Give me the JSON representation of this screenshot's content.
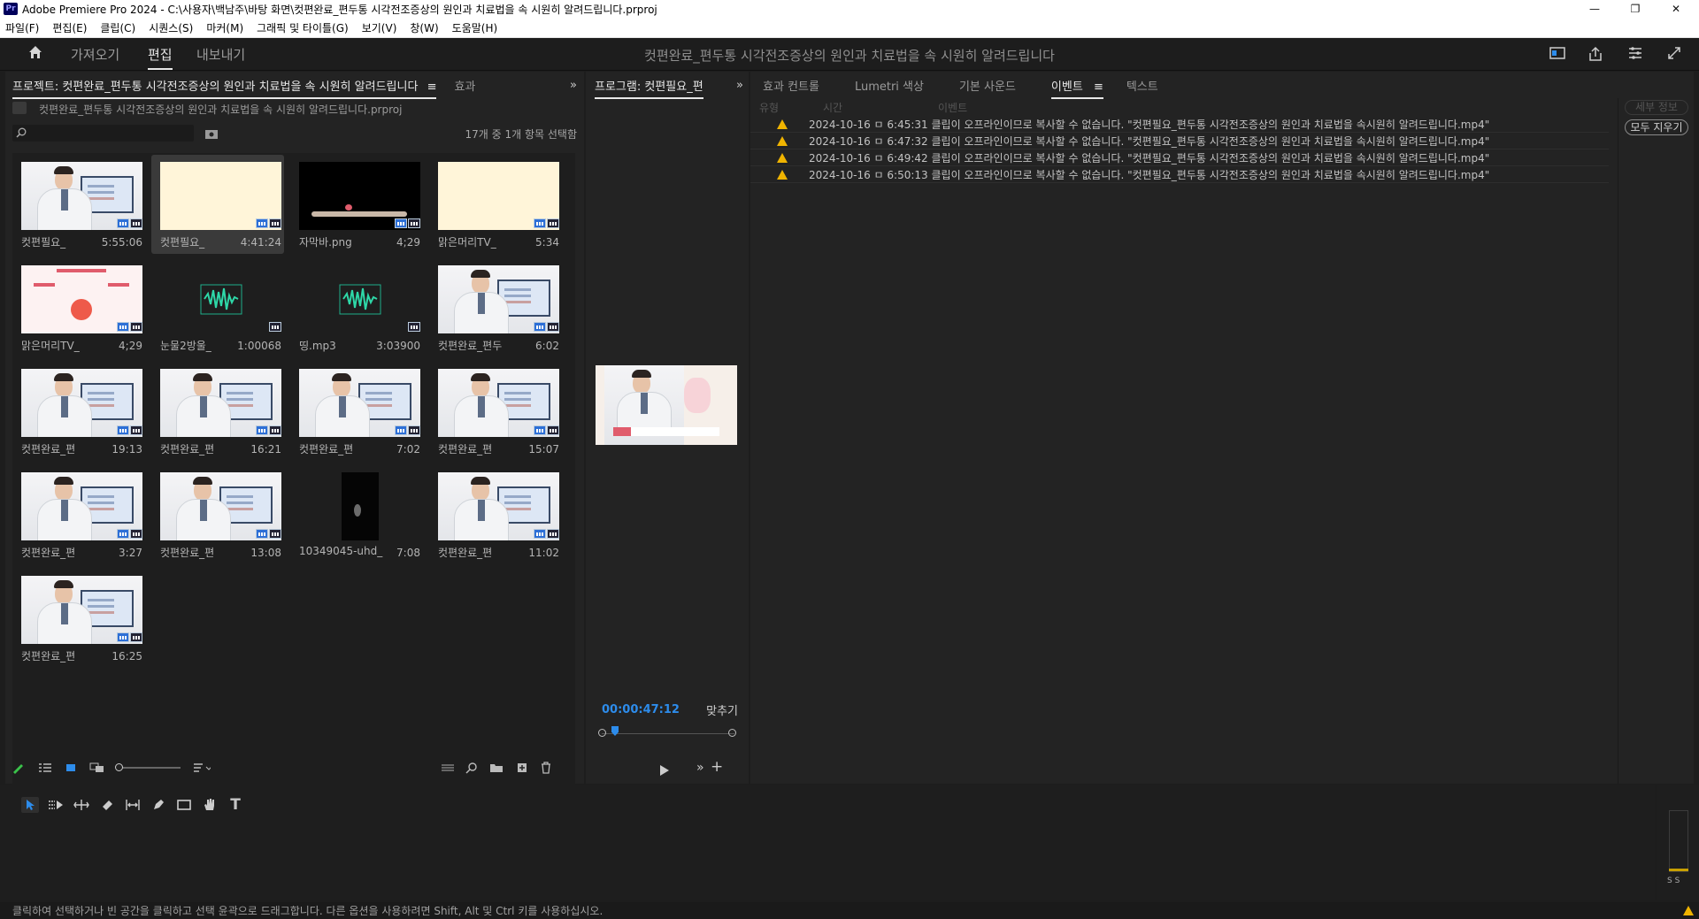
{
  "window": {
    "title": "Adobe Premiere Pro 2024 - C:\\사용자\\백남주\\바탕 화면\\컷편완료_편두통 시각전조증상의 원인과 치료법을 속 시원히 알려드립니다.prproj",
    "app_badge": "Pr",
    "controls": {
      "minimize": "—",
      "restore": "❐",
      "close": "✕"
    }
  },
  "menu": [
    "파일(F)",
    "편집(E)",
    "클립(C)",
    "시퀀스(S)",
    "마커(M)",
    "그래픽 및 타이틀(G)",
    "보기(V)",
    "창(W)",
    "도움말(H)"
  ],
  "header": {
    "tabs": {
      "import": "가져오기",
      "edit": "편집",
      "export": "내보내기"
    },
    "doc_title": "컷편완료_편두통 시각전조증상의 원인과 치료법을 속 시원히 알려드립니다"
  },
  "project_panel": {
    "tab_label": "프로젝트: 컷편완료_편두통 시각전조증상의 원인과 치료법을 속 시원히 알려드립니다",
    "menu_icon": "≡",
    "effects_tab": "효과",
    "overflow": "»",
    "file_name": "컷편완료_편두통 시각전조증상의 원인과 치료법을 속 시원히 알려드립니다.prproj",
    "search_placeholder": "",
    "selection_status": "17개 중 1개 항목 선택함",
    "clips": [
      {
        "name": "컷편필요_",
        "duration": "5:55:06",
        "type": "person"
      },
      {
        "name": "컷편필요_",
        "duration": "4:41:24",
        "type": "cream",
        "selected": true
      },
      {
        "name": "자막바.png",
        "duration": "4;29",
        "type": "black-bar"
      },
      {
        "name": "맑은머리TV_",
        "duration": "5:34",
        "type": "cream"
      },
      {
        "name": "맑은머리TV_",
        "duration": "4;29",
        "type": "slide"
      },
      {
        "name": "눈물2방울_",
        "duration": "1:00068",
        "type": "audio"
      },
      {
        "name": "띵.mp3",
        "duration": "3:03900",
        "type": "audio"
      },
      {
        "name": "컷편완료_편두",
        "duration": "6:02",
        "type": "person"
      },
      {
        "name": "컷편완료_편",
        "duration": "19:13",
        "type": "person"
      },
      {
        "name": "컷편완료_편",
        "duration": "16:21",
        "type": "person"
      },
      {
        "name": "컷편완료_편",
        "duration": "7:02",
        "type": "person"
      },
      {
        "name": "컷편완료_편",
        "duration": "15:07",
        "type": "person"
      },
      {
        "name": "컷편완료_편",
        "duration": "3:27",
        "type": "person"
      },
      {
        "name": "컷편완료_편",
        "duration": "13:08",
        "type": "person"
      },
      {
        "name": "10349045-uhd_",
        "duration": "7:08",
        "type": "dark-video"
      },
      {
        "name": "컷편완료_편",
        "duration": "11:02",
        "type": "person"
      },
      {
        "name": "컷편완료_편",
        "duration": "16:25",
        "type": "person"
      }
    ]
  },
  "program_panel": {
    "tab_label": "프로그램: 컷편필요_편",
    "overflow": "»",
    "timecode": "00:00:47:12",
    "fit_label": "맞추기"
  },
  "events_panel": {
    "tabs": {
      "effect_controls": "효과 컨트롤",
      "lumetri": "Lumetri 색상",
      "basic_sound": "기본 사운드",
      "events": "이벤트",
      "text": "텍스트"
    },
    "menu_icon": "≡",
    "columns": {
      "type": "유형",
      "time": "시간",
      "event": "이벤트"
    },
    "details_button": "세부 정보",
    "clear_all_button": "모두 지우기",
    "rows": [
      {
        "time": "2024-10-16 ㅁ 6:45:31",
        "message": "클립이 오프라인이므로 복사할 수 없습니다. \"컷편필요_편두통 시각전조증상의 원인과 치료법을 속시원히 알려드립니다.mp4\""
      },
      {
        "time": "2024-10-16 ㅁ 6:47:32",
        "message": "클립이 오프라인이므로 복사할 수 없습니다. \"컷편필요_편두통 시각전조증상의 원인과 치료법을 속시원히 알려드립니다.mp4\""
      },
      {
        "time": "2024-10-16 ㅁ 6:49:42",
        "message": "클립이 오프라인이므로 복사할 수 없습니다. \"컷편필요_편두통 시각전조증상의 원인과 치료법을 속시원히 알려드립니다.mp4\""
      },
      {
        "time": "2024-10-16 ㅁ 6:50:13",
        "message": "클립이 오프라인이므로 복사할 수 없습니다. \"컷편필요_편두통 시각전조증상의 원인과 치료법을 속시원히 알려드립니다.mp4\""
      }
    ]
  },
  "meters": {
    "solo_labels": "S S"
  },
  "status_bar": "클릭하여 선택하거나 빈 공간을 클릭하고 선택 윤곽으로 드래그합니다. 다른 옵션을 사용하려면 Shift, Alt 및 Ctrl 키를 사용하십시오.",
  "colors": {
    "accent_blue": "#2d8ceb",
    "warning": "#f0b400",
    "panel_bg": "#232323",
    "app_bg": "#1d1d1d"
  }
}
